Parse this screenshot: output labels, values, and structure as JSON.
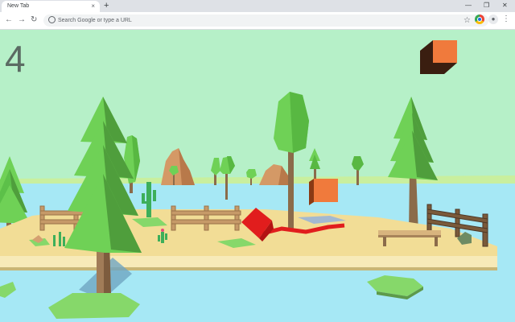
{
  "browser": {
    "tab_title": "New Tab",
    "tab_close": "×",
    "new_tab": "+",
    "window_minimize": "—",
    "window_restore": "❐",
    "window_close": "✕",
    "back": "←",
    "forward": "→",
    "reload": "↻",
    "omnibox_placeholder": "Search Google or type a URL",
    "bookmark": "☆",
    "menu": "⋮"
  },
  "game": {
    "score": "4"
  },
  "colors": {
    "sky": "#b6f0c8",
    "water": "#a6e8f5",
    "sand": "#f2dd96",
    "grass": "#86d86a",
    "player": "#e11d1d",
    "pickup": "#f07a3c"
  }
}
